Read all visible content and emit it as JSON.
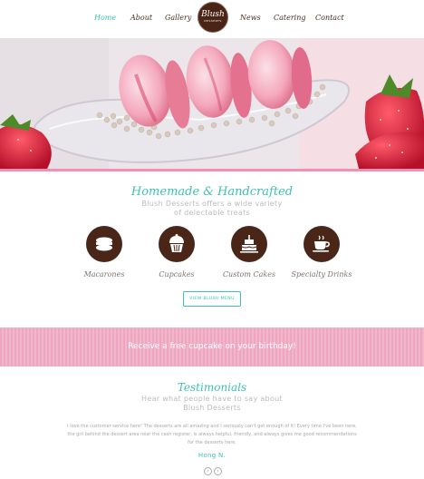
{
  "nav": {
    "items": [
      {
        "label": "Home",
        "active": true
      },
      {
        "label": "About"
      },
      {
        "label": "Gallery"
      },
      {
        "label": "News"
      },
      {
        "label": "Catering"
      },
      {
        "label": "Contact"
      }
    ],
    "logo": {
      "name": "Blush",
      "tagline": "DESSERTS"
    }
  },
  "hero": {
    "image": "pink macarons on a glass dish with pearl sprinkles and strawberries"
  },
  "intro": {
    "title": "Homemade & Handcrafted",
    "subtitle_line1": "Blush Desserts offers a wide variety",
    "subtitle_line2": "of delectable treats"
  },
  "features": [
    {
      "label": "Macarones",
      "icon": "macaron-icon"
    },
    {
      "label": "Cupcakes",
      "icon": "cupcake-icon"
    },
    {
      "label": "Custom Cakes",
      "icon": "cake-icon"
    },
    {
      "label": "Specialty Drinks",
      "icon": "coffee-cup-icon"
    }
  ],
  "menu_button": "VIEW BLUSH MENU",
  "promo": {
    "text": "Receive a free cupcake on your birthday!"
  },
  "testimonials": {
    "title": "Testimonials",
    "subtitle_line1": "Hear what people have to say about",
    "subtitle_line2": "Blush Desserts",
    "quote": "I love the customer service here! The desserts are all amazing and I seriously can't get enough of it! Every time I've been here, the girl behind the dessert area near the cash register, is always helpful, friendly, and always gives me good recommendations for the desserts here.",
    "author": "Hong N."
  },
  "colors": {
    "accent": "#3cc3b4",
    "brown": "#4a2618",
    "pink": "#f38fb4",
    "promo_pink": "#f0adc5"
  }
}
